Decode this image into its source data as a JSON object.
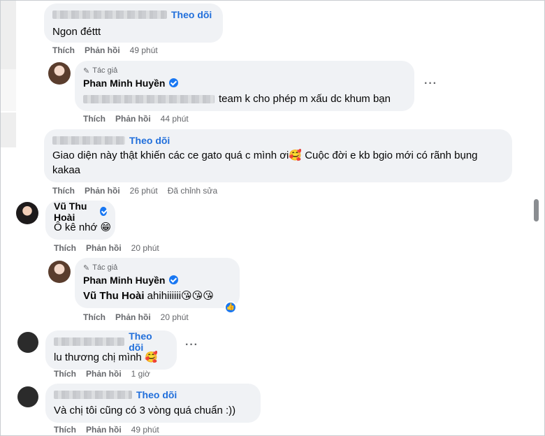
{
  "colors": {
    "bubble": "#f0f2f5",
    "link": "#216fdb",
    "meta": "#65676b",
    "verified": "#1877f2"
  },
  "comments": [
    {
      "follow": "Theo dõi",
      "text": "Ngon đéttt",
      "actions": [
        "Thích",
        "Phản hồi"
      ],
      "time": "49 phút"
    },
    {
      "tag": "Tác giả",
      "name": "Phan Minh Huyền",
      "text": "team k cho phép m xấu dc khum bạn",
      "actions": [
        "Thích",
        "Phản hồi"
      ],
      "time": "44 phút"
    },
    {
      "follow": "Theo dõi",
      "text": "Giao diện này thật khiến các ce gato quá c mình ơi🥰 Cuộc đời e kb bgio mới có rãnh bụng kakaa",
      "actions": [
        "Thích",
        "Phản hồi"
      ],
      "time": "26 phút",
      "edited": "Đã chỉnh sửa"
    },
    {
      "name": "Vũ Thu Hoài",
      "text": "Ô kê nhớ 😁",
      "actions": [
        "Thích",
        "Phản hồi"
      ],
      "time": "20 phút"
    },
    {
      "tag": "Tác giả",
      "name": "Phan Minh Huyền",
      "mention": "Vũ Thu Hoài",
      "text": "ahihiiiiii😘😘😘",
      "actions": [
        "Thích",
        "Phản hồi"
      ],
      "time": "20 phút"
    },
    {
      "follow": "Theo dõi",
      "text": "lu thương chị mình 🥰",
      "actions": [
        "Thích",
        "Phản hồi"
      ],
      "time": "1 giờ"
    },
    {
      "follow": "Theo dõi",
      "text": "Và chị tôi cũng có 3 vòng quá chuẩn :))",
      "actions": [
        "Thích",
        "Phản hồi"
      ],
      "time": "49 phút"
    }
  ],
  "icons": {
    "more": "more-options-icon",
    "like": "like-reaction-icon",
    "pen": "author-pen-icon"
  }
}
